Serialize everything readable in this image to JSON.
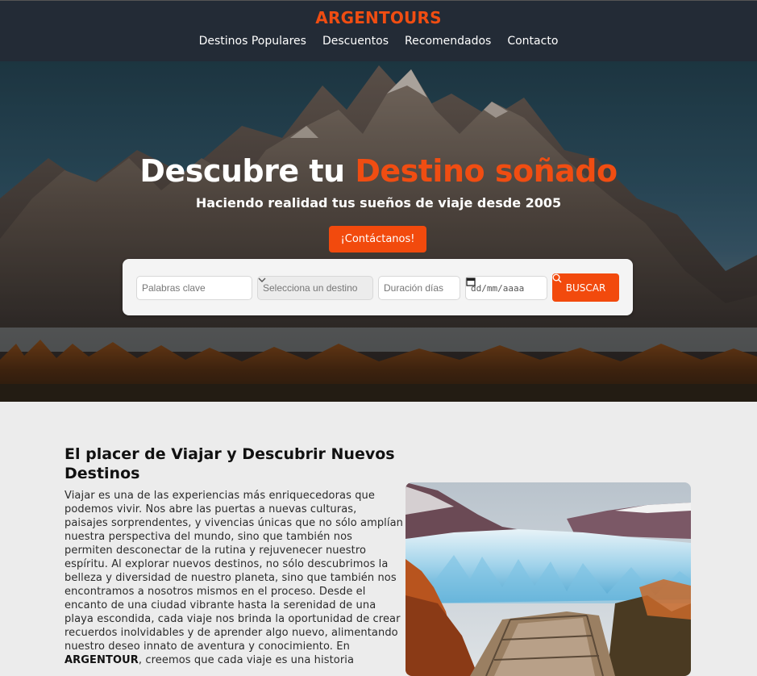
{
  "header": {
    "brand": "ARGENTOURS",
    "nav": [
      "Destinos Populares",
      "Descuentos",
      "Recomendados",
      "Contacto"
    ]
  },
  "hero": {
    "title_main": "Descubre tu ",
    "title_accent": "Destino soñado",
    "subtitle": "Haciendo realidad tus sueños de viaje desde 2005",
    "contact_button": "¡Contáctanos!"
  },
  "search": {
    "keywords_placeholder": "Palabras clave",
    "destination_selected": "Selecciona un destino",
    "duration_placeholder": "Duración días",
    "date_placeholder": "dd/mm/aaaa",
    "button": "BUSCAR"
  },
  "about": {
    "title": "El placer de Viajar y Descubrir Nuevos Destinos",
    "body_before_bold": "Viajar es una de las experiencias más enriquecedoras que podemos vivir. Nos abre las puertas a nuevas culturas, paisajes sorprendentes, y vivencias únicas que no sólo amplían nuestra perspectiva del mundo, sino que también nos permiten desconectar de la rutina y rejuvenecer nuestro espíritu. Al explorar nuevos destinos, no sólo descubrimos la belleza y diversidad de nuestro planeta, sino que también nos encontramos a nosotros mismos en el proceso. Desde el encanto de una ciudad vibrante hasta la serenidad de una playa escondida, cada viaje nos brinda la oportunidad de crear recuerdos inolvidables y de aprender algo nuevo, alimentando nuestro deseo innato de aventura y conocimiento. En ",
    "bold_word": "ARGENTOUR",
    "body_after_bold": ", creemos que cada viaje es una historia"
  },
  "colors": {
    "accent": "#f04d12",
    "header_bg": "#232b36",
    "content_bg": "#ececec"
  }
}
